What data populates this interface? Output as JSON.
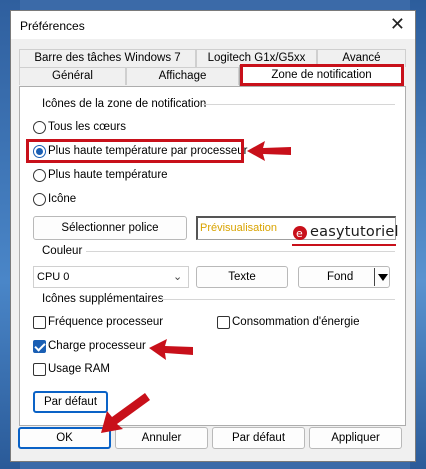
{
  "window": {
    "title": "Préférences",
    "close_glyph": "✕"
  },
  "tabs_row1": [
    {
      "label": "Barre des tâches Windows 7"
    },
    {
      "label": "Logitech G1x/G5xx"
    },
    {
      "label": "Avancé"
    }
  ],
  "tabs_row2": [
    {
      "label": "Général"
    },
    {
      "label": "Affichage"
    },
    {
      "label": "Zone de notification",
      "active": true
    }
  ],
  "icons_group": {
    "title": "Icônes de la zone de notification",
    "options": [
      {
        "label": "Tous les cœurs",
        "selected": false
      },
      {
        "label": "Plus haute température par processeur",
        "selected": true
      },
      {
        "label": "Plus haute température",
        "selected": false
      },
      {
        "label": "Icône",
        "selected": false
      }
    ],
    "font_button": "Sélectionner police",
    "preview_text": "Prévisualisation"
  },
  "watermark": {
    "text": "easytutoriel",
    "logo_glyph": "e"
  },
  "color_group": {
    "title": "Couleur",
    "cpu_select": "CPU 0",
    "text_button": "Texte",
    "bg_button": "Fond"
  },
  "extra_group": {
    "title": "Icônes supplémentaires",
    "items": [
      {
        "label": "Fréquence processeur",
        "checked": false
      },
      {
        "label": "Consommation d'énergie",
        "checked": false
      },
      {
        "label": "Charge processeur",
        "checked": true
      },
      {
        "label": "Usage RAM",
        "checked": false
      }
    ],
    "default_button": "Par défaut"
  },
  "footer": {
    "ok": "OK",
    "cancel": "Annuler",
    "default": "Par défaut",
    "apply": "Appliquer"
  },
  "colors": {
    "accent": "#1a5fb4",
    "annotation": "#c8101a",
    "preview": "#d9a300"
  }
}
